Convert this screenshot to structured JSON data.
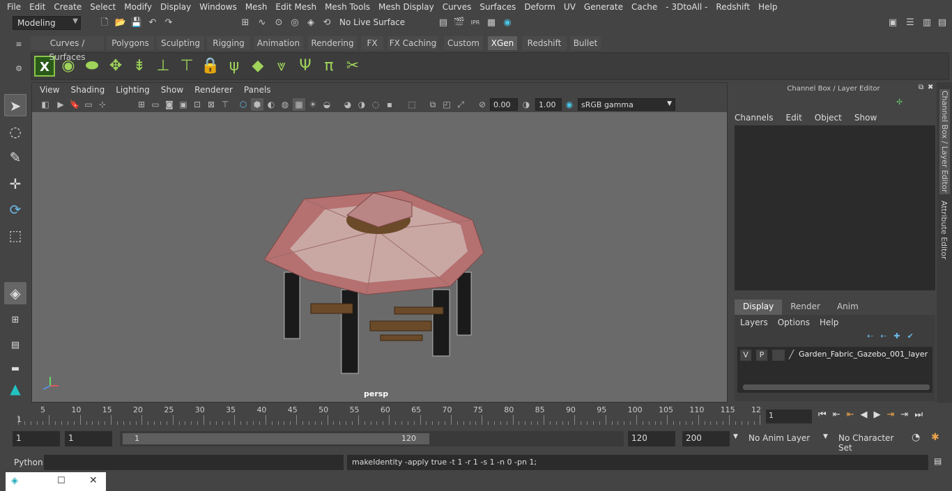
{
  "menubar": [
    "File",
    "Edit",
    "Create",
    "Select",
    "Modify",
    "Display",
    "Windows",
    "Mesh",
    "Edit Mesh",
    "Mesh Tools",
    "Mesh Display",
    "Curves",
    "Surfaces",
    "Deform",
    "UV",
    "Generate",
    "Cache",
    "- 3DtoAll -",
    "Redshift",
    "Help"
  ],
  "status": {
    "workspace": "Modeling",
    "live_surface": "No Live Surface"
  },
  "shelf_tabs": [
    "Curves / Surfaces",
    "Polygons",
    "Sculpting",
    "Rigging",
    "Animation",
    "Rendering",
    "FX",
    "FX Caching",
    "Custom",
    "XGen",
    "Redshift",
    "Bullet"
  ],
  "active_shelf_tab": "XGen",
  "viewport": {
    "menu": [
      "View",
      "Shading",
      "Lighting",
      "Show",
      "Renderer",
      "Panels"
    ],
    "exposure": "0.00",
    "gamma": "1.00",
    "color_space": "sRGB gamma",
    "camera_label": "persp"
  },
  "channel_box": {
    "title": "Channel Box / Layer Editor",
    "menu": [
      "Channels",
      "Edit",
      "Object",
      "Show"
    ],
    "tabs": [
      "Display",
      "Render",
      "Anim"
    ],
    "active_tab": "Display",
    "layer_menu": [
      "Layers",
      "Options",
      "Help"
    ],
    "layer": {
      "v": "V",
      "p": "P",
      "name": "Garden_Fabric_Gazebo_001_layer"
    }
  },
  "side_tabs": [
    "Channel Box / Layer Editor",
    "Attribute Editor"
  ],
  "timeline": {
    "labels": [
      "5",
      "10",
      "15",
      "20",
      "25",
      "30",
      "35",
      "40",
      "45",
      "50",
      "55",
      "60",
      "65",
      "70",
      "75",
      "80",
      "85",
      "90",
      "95",
      "100",
      "105",
      "110",
      "115",
      "12"
    ],
    "start_marker": "1",
    "current_frame": "1"
  },
  "range": {
    "start": "1",
    "start2": "1",
    "slider_start": "1",
    "slider_end": "120",
    "end": "120",
    "end2": "200",
    "anim_layer": "No Anim Layer",
    "char_set": "No Character Set"
  },
  "cmd": {
    "label": "Python",
    "output": "makeIdentity -apply true -t 1 -r 1 -s 1 -n 0 -pn 1;"
  }
}
